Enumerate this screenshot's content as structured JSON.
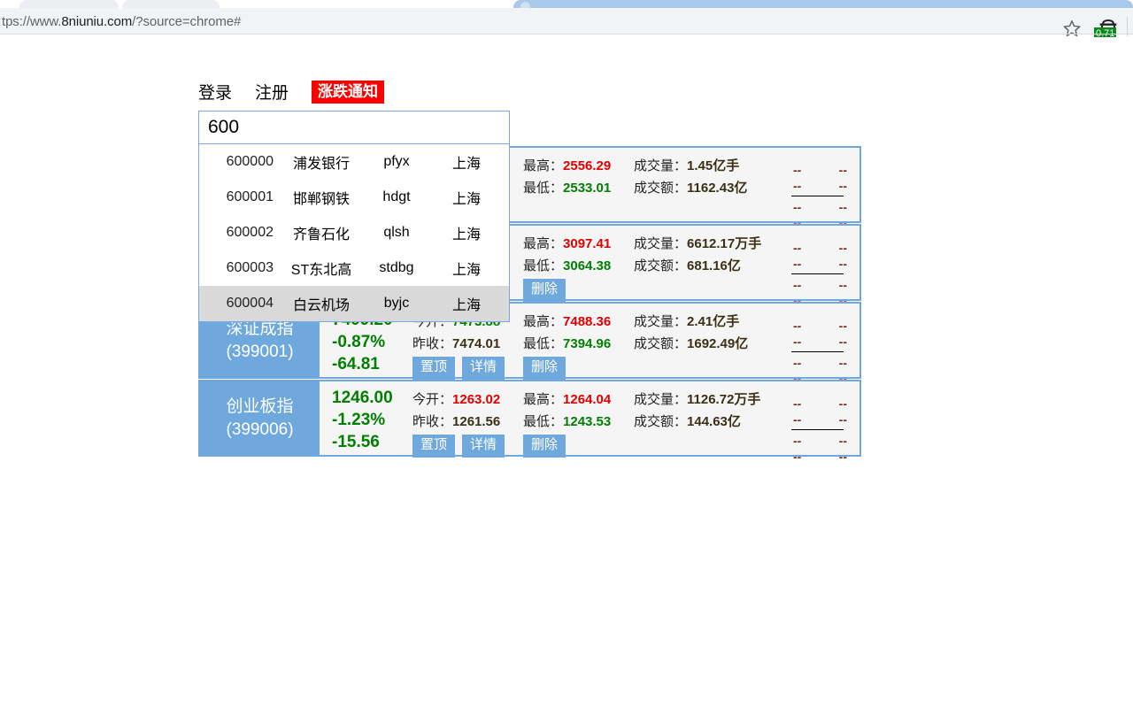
{
  "browser": {
    "url_prefix": "tps://www.",
    "url_host": "8niuniu.com",
    "url_suffix": "/?source=chrome#",
    "star_icon": "bookmark-star-icon",
    "extension_icon": "extension-icon",
    "extension_badge": "0.71"
  },
  "topnav": {
    "login": "登录",
    "register": "注册",
    "notify_badge": "涨跌通知"
  },
  "search": {
    "value": "600",
    "placeholder": ""
  },
  "autocomplete": {
    "rows": [
      {
        "code": "600000",
        "name": "浦发银行",
        "pinyin": "pfyx",
        "city": "上海",
        "selected": false
      },
      {
        "code": "600001",
        "name": "邯郸钢铁",
        "pinyin": "hdgt",
        "city": "上海",
        "selected": false
      },
      {
        "code": "600002",
        "name": "齐鲁石化",
        "pinyin": "qlsh",
        "city": "上海",
        "selected": false
      },
      {
        "code": "600003",
        "name": "ST东北高",
        "pinyin": "stdbg",
        "city": "上海",
        "selected": false
      },
      {
        "code": "600004",
        "name": "白云机场",
        "pinyin": "byjc",
        "city": "上海",
        "selected": true
      }
    ]
  },
  "labels": {
    "open": "今开：",
    "prev_close": "昨收：",
    "high": "最高：",
    "low": "最低：",
    "volume": "成交量：",
    "turnover": "成交额：",
    "pin": "置顶",
    "detail": "详情",
    "delete": "删除",
    "dash": "--"
  },
  "colors": {
    "accent_blue": "#6fa8dc",
    "border_blue": "#6fa8dc",
    "down_green": "#008000",
    "up_red": "#e00000",
    "badge_red": "#ff0000",
    "card_bg": "#f5f5f5",
    "dash_maroon": "#7b2a1a"
  },
  "cards": [
    {
      "name": "",
      "code": "",
      "price": "",
      "pct": "",
      "change": "",
      "open": "",
      "prev_close": "",
      "high": "2556.29",
      "low": "2533.01",
      "volume": "1.45亿手",
      "turnover": "1162.43亿",
      "occluded": true,
      "show_buttons": false
    },
    {
      "name": "",
      "code": "",
      "price": "",
      "pct": "",
      "change": "",
      "open": "",
      "prev_close": "",
      "high": "3097.41",
      "low": "3064.38",
      "volume": "6612.17万手",
      "turnover": "681.16亿",
      "occluded": true,
      "show_buttons": true
    },
    {
      "name": "深证成指",
      "code": "(399001)",
      "price": "7409.20",
      "pct": "-0.87%",
      "change": "-64.81",
      "open": "7473.88",
      "open_dir": "down",
      "prev_close": "7474.01",
      "high": "7488.36",
      "low": "7394.96",
      "volume": "2.41亿手",
      "turnover": "1692.49亿",
      "occluded": false,
      "show_buttons": true
    },
    {
      "name": "创业板指",
      "code": "(399006)",
      "price": "1246.00",
      "pct": "-1.23%",
      "change": "-15.56",
      "open": "1263.02",
      "open_dir": "up",
      "prev_close": "1261.56",
      "high": "1264.04",
      "low": "1243.53",
      "volume": "1126.72万手",
      "turnover": "144.63亿",
      "occluded": false,
      "show_buttons": true
    }
  ]
}
